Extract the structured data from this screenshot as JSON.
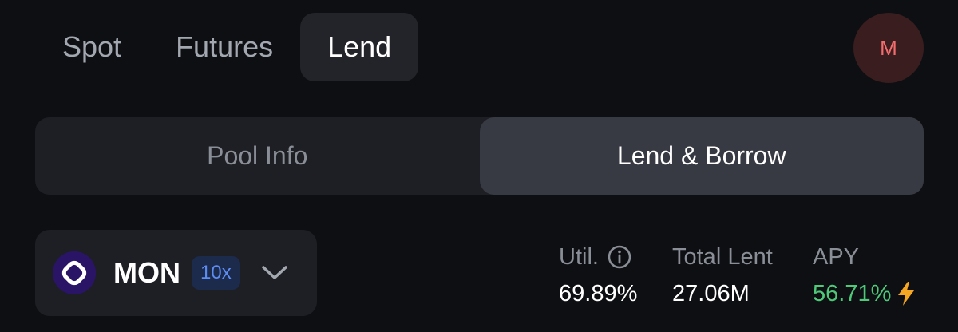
{
  "nav": {
    "tabs": [
      {
        "label": "Spot"
      },
      {
        "label": "Futures"
      },
      {
        "label": "Lend",
        "active": true
      }
    ],
    "avatar_initial": "M"
  },
  "segment": {
    "options": [
      {
        "label": "Pool Info"
      },
      {
        "label": "Lend & Borrow",
        "active": true
      }
    ]
  },
  "asset": {
    "symbol": "MON",
    "leverage": "10x",
    "icon": "mon-token-icon",
    "dropdown_icon": "chevron-down-icon"
  },
  "stats": {
    "util": {
      "label": "Util.",
      "value": "69.89%",
      "icon": "info-icon"
    },
    "total_lent": {
      "label": "Total Lent",
      "value": "27.06M"
    },
    "apy": {
      "label": "APY",
      "value": "56.71%",
      "icon": "lightning-bolt-icon"
    }
  },
  "colors": {
    "background": "#0e0f13",
    "panel": "#1e1f24",
    "active_segment": "#383a43",
    "apy_green": "#4ec979",
    "bolt_yellow": "#f5a623",
    "badge_blue": "#5d8cf2",
    "avatar_red": "#f26d6d"
  }
}
